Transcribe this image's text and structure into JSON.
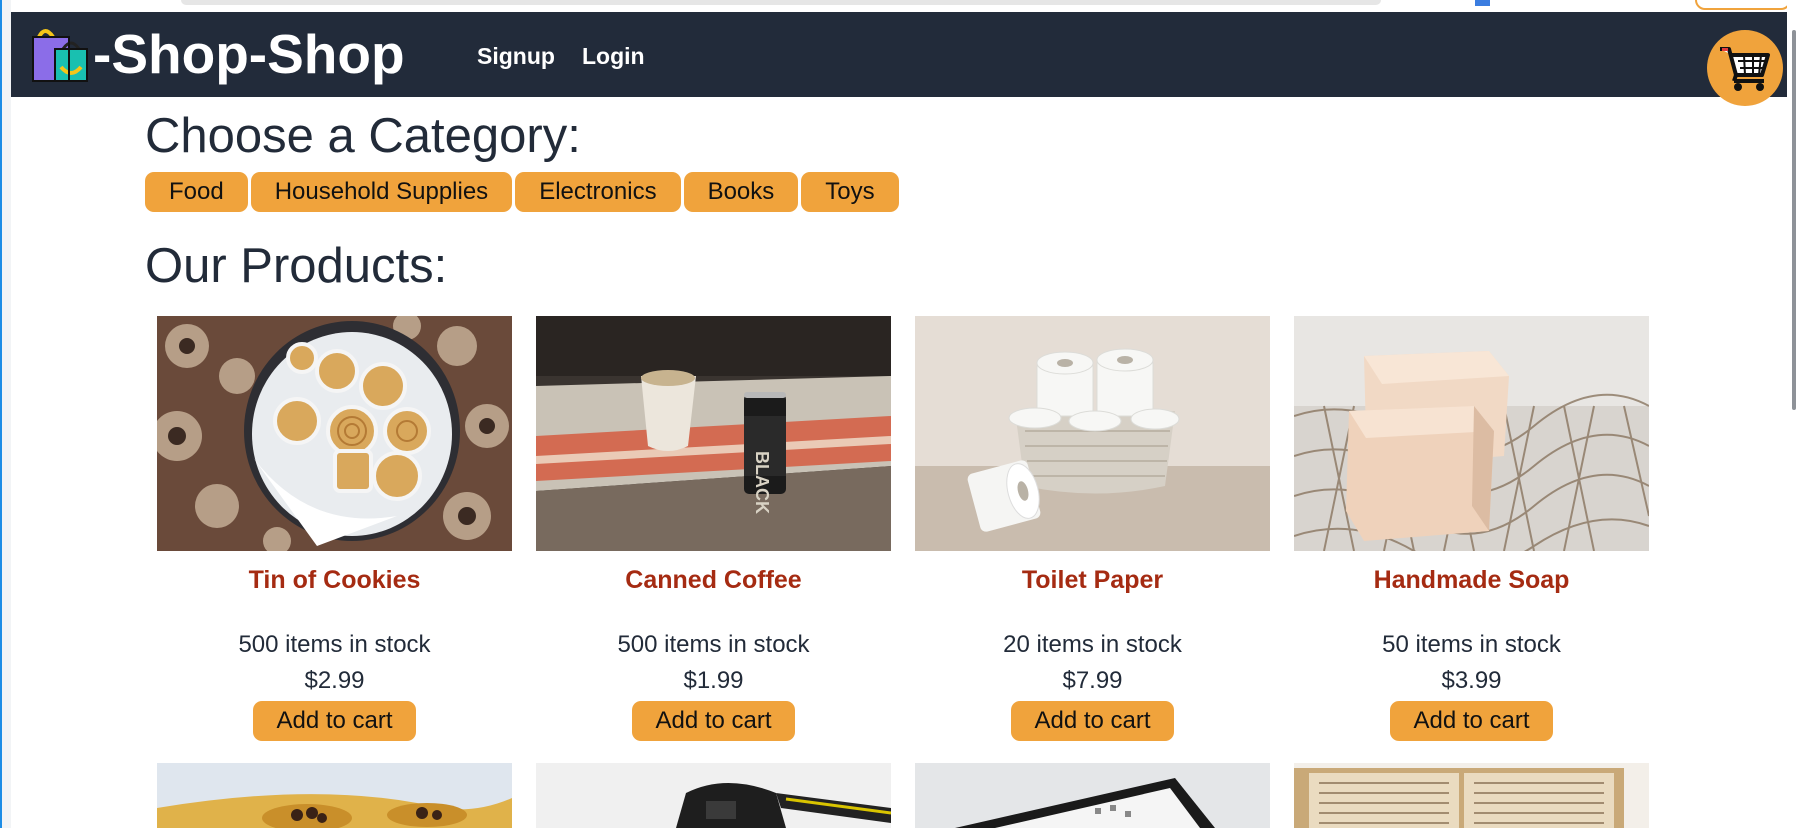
{
  "navbar": {
    "brand": "-Shop-Shop",
    "links": [
      "Signup",
      "Login"
    ],
    "logo_icon": "shopping-bags-icon",
    "cart_icon": "shopping-cart-icon"
  },
  "categories": {
    "heading": "Choose a Category:",
    "items": [
      "Food",
      "Household Supplies",
      "Electronics",
      "Books",
      "Toys"
    ]
  },
  "products": {
    "heading": "Our Products:",
    "items": [
      {
        "name": "Tin of Cookies",
        "stock": "500 items in stock",
        "price": "$2.99",
        "button": "Add to cart"
      },
      {
        "name": "Canned Coffee",
        "stock": "500 items in stock",
        "price": "$1.99",
        "button": "Add to cart"
      },
      {
        "name": "Toilet Paper",
        "stock": "20 items in stock",
        "price": "$7.99",
        "button": "Add to cart"
      },
      {
        "name": "Handmade Soap",
        "stock": "50 items in stock",
        "price": "$3.99",
        "button": "Add to cart"
      }
    ]
  },
  "colors": {
    "navbar": "#222b3a",
    "accent": "#f0a33c",
    "product_name": "#a52b12",
    "text": "#222b39"
  }
}
